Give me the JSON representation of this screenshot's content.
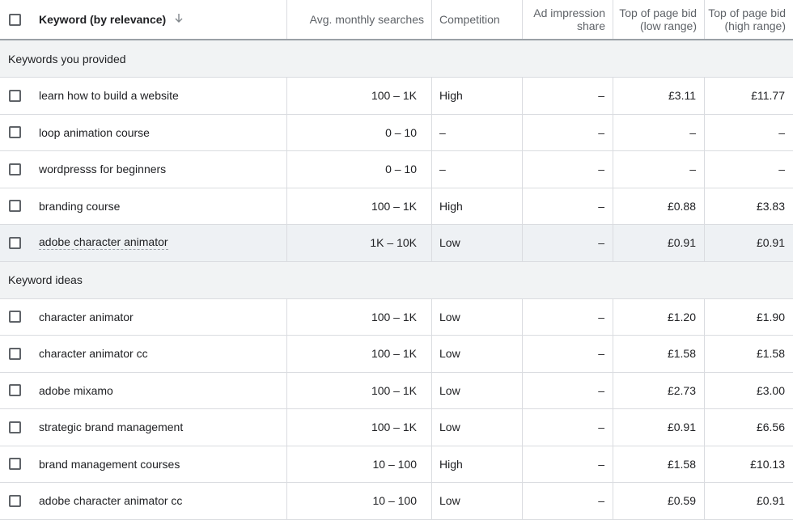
{
  "header": {
    "keyword_label": "Keyword (by relevance)",
    "sort_icon": "arrow-down-icon",
    "avg_searches": "Avg. monthly searches",
    "competition": "Competition",
    "ad_share_line1": "Ad impression",
    "ad_share_line2": "share",
    "low_bid_line1": "Top of page bid",
    "low_bid_line2": "(low range)",
    "high_bid_line1": "Top of page bid",
    "high_bid_line2": "(high range)"
  },
  "sections": {
    "provided": "Keywords you provided",
    "ideas": "Keyword ideas"
  },
  "provided_rows": [
    {
      "keyword": "learn how to build a website",
      "searches": "100 – 1K",
      "competition": "High",
      "share": "–",
      "low": "£3.11",
      "high": "£11.77"
    },
    {
      "keyword": "loop animation course",
      "searches": "0 – 10",
      "competition": "–",
      "share": "–",
      "low": "–",
      "high": "–"
    },
    {
      "keyword": "wordpresss for beginners",
      "searches": "0 – 10",
      "competition": "–",
      "share": "–",
      "low": "–",
      "high": "–"
    },
    {
      "keyword": "branding course",
      "searches": "100 – 1K",
      "competition": "High",
      "share": "–",
      "low": "£0.88",
      "high": "£3.83"
    },
    {
      "keyword": "adobe character animator",
      "searches": "1K – 10K",
      "competition": "Low",
      "share": "–",
      "low": "£0.91",
      "high": "£0.91"
    }
  ],
  "idea_rows": [
    {
      "keyword": "character animator",
      "searches": "100 – 1K",
      "competition": "Low",
      "share": "–",
      "low": "£1.20",
      "high": "£1.90"
    },
    {
      "keyword": "character animator cc",
      "searches": "100 – 1K",
      "competition": "Low",
      "share": "–",
      "low": "£1.58",
      "high": "£1.58"
    },
    {
      "keyword": "adobe mixamo",
      "searches": "100 – 1K",
      "competition": "Low",
      "share": "–",
      "low": "£2.73",
      "high": "£3.00"
    },
    {
      "keyword": "strategic brand management",
      "searches": "100 – 1K",
      "competition": "Low",
      "share": "–",
      "low": "£0.91",
      "high": "£6.56"
    },
    {
      "keyword": "brand management courses",
      "searches": "10 – 100",
      "competition": "High",
      "share": "–",
      "low": "£1.58",
      "high": "£10.13"
    },
    {
      "keyword": "adobe character animator cc",
      "searches": "10 – 100",
      "competition": "Low",
      "share": "–",
      "low": "£0.59",
      "high": "£0.91"
    }
  ]
}
